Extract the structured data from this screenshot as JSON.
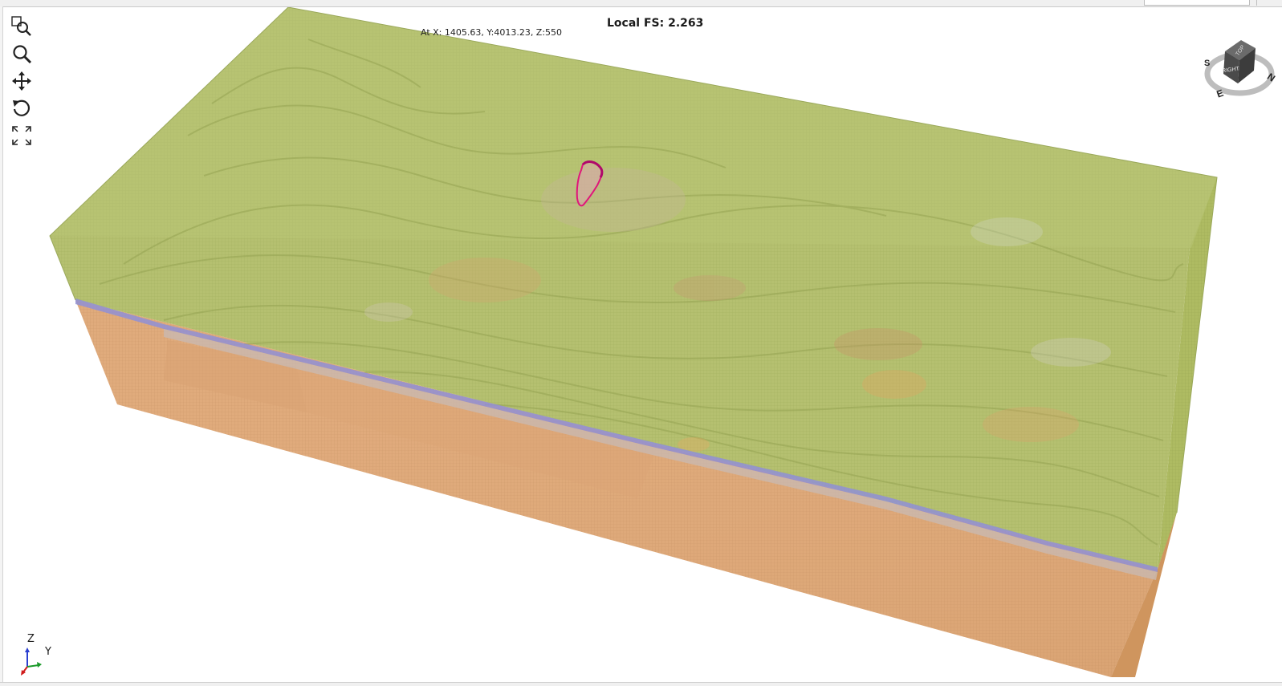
{
  "viewer": {
    "title_prefix": "Local FS:",
    "title_value": "2.263",
    "cursor_readout": "At X: 1405.63, Y:4013.23, Z:550"
  },
  "toolbar": [
    {
      "name": "zoom-window-icon",
      "label": "Zoom Window"
    },
    {
      "name": "zoom-icon",
      "label": "Zoom"
    },
    {
      "name": "pan-icon",
      "label": "Pan"
    },
    {
      "name": "rotate-icon",
      "label": "Rotate"
    },
    {
      "name": "zoom-extents-icon",
      "label": "Zoom Extents"
    }
  ],
  "navcube": {
    "top_face": "TOP",
    "front_face": "RIGHT",
    "compass": [
      "S",
      "E",
      "N"
    ]
  },
  "axes": {
    "z": "Z",
    "y": "Y"
  },
  "colors": {
    "surface_soil": "#b3bf6a",
    "bedrock": "#dea878",
    "weak_layer": "#8f8fd6",
    "slip_surface": "#e0157a"
  }
}
